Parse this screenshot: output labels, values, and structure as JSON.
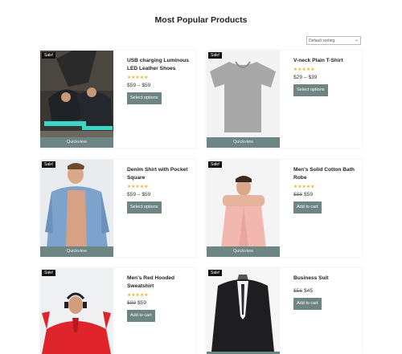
{
  "page": {
    "title": "Most Popular Products"
  },
  "sort": {
    "selected": "Default sorting"
  },
  "products": [
    {
      "name": "USB charging Luminous LED Leather Shoes",
      "badge": "Sale!",
      "price": "$59 – $59",
      "button": "Select options",
      "quickview": "Quickview",
      "rating": 5
    },
    {
      "name": "V-neck Plain T-Shirt",
      "badge": "Sale!",
      "price": "$29 – $39",
      "button": "Select options",
      "quickview": "Quickview",
      "rating": 5
    },
    {
      "name": "Denim Shirt with Pocket Square",
      "badge": "Sale!",
      "price": "$59 – $59",
      "button": "Select options",
      "quickview": "Quickview",
      "rating": 5
    },
    {
      "name": "Men's Solid Cotton Bath Robe",
      "badge": "Sale!",
      "old_price": "$88",
      "price": "$59",
      "button": "Add to cart",
      "quickview": "Quickview",
      "rating": 5
    },
    {
      "name": "Men's Red Hooded Sweatshirt",
      "badge": "Sale!",
      "old_price": "$99",
      "price": "$59",
      "button": "Add to cart",
      "rating": 5
    },
    {
      "name": "Business Suit",
      "badge": "Sale!",
      "old_price": "$56",
      "price": "$45",
      "button": "Add to cart"
    }
  ],
  "stars_glyph": "★★★★★",
  "colors": {
    "accent": "#6d8583",
    "star": "#f2b01e",
    "badge": "#111111"
  }
}
